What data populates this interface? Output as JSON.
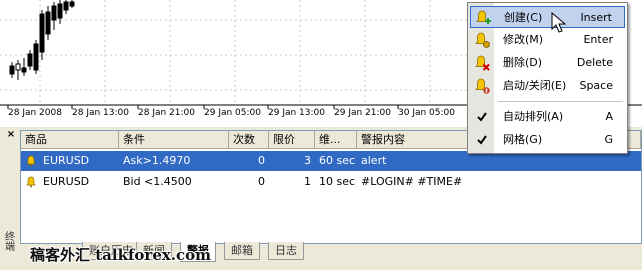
{
  "chart": {
    "x_ticks": [
      "28 Jan 2008",
      "28 Jan 13:00",
      "28 Jan 21:00",
      "29 Jan 05:00",
      "29 Jan 13:00",
      "29 Jan 21:00",
      "30 Jan 05:00"
    ]
  },
  "terminal": {
    "close_glyph": "×",
    "side_label": "终端",
    "columns": [
      "商品",
      "条件",
      "次数",
      "限价",
      "维...",
      "警报内容"
    ],
    "rows": [
      {
        "symbol": "EURUSD",
        "condition": "Ask>1.4970",
        "count": "0",
        "limit": "3",
        "timeout": "60 sec",
        "content": "alert",
        "selected": true
      },
      {
        "symbol": "EURUSD",
        "condition": "Bid <1.4500",
        "count": "0",
        "limit": "1",
        "timeout": "10 sec",
        "content": "#LOGIN# #TIME#",
        "selected": false
      }
    ],
    "tabs": [
      "账户历史",
      "新闻",
      "警报",
      "邮箱",
      "日志"
    ],
    "active_tab": "警报"
  },
  "context_menu": {
    "items": [
      {
        "label": "创建(C)",
        "shortcut": "Insert",
        "icon": "bell-add-icon"
      },
      {
        "label": "修改(M)",
        "shortcut": "Enter",
        "icon": "bell-edit-icon"
      },
      {
        "label": "删除(D)",
        "shortcut": "Delete",
        "icon": "bell-delete-icon"
      },
      {
        "label": "启动/关闭(E)",
        "shortcut": "Space",
        "icon": "bell-toggle-icon"
      },
      {
        "label": "自动排列(A)",
        "shortcut": "A",
        "icon": "check-icon"
      },
      {
        "label": "网格(G)",
        "shortcut": "G",
        "icon": "check-icon"
      }
    ]
  },
  "watermark": {
    "text": "稿客外汇 talkforex.com"
  }
}
